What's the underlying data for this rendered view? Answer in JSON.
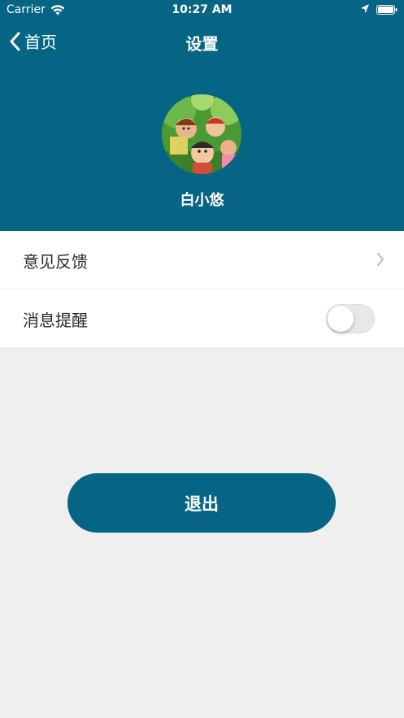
{
  "status_bar": {
    "carrier": "Carrier",
    "time": "10:27 AM",
    "icons": [
      "wifi-icon",
      "location-arrow-icon",
      "battery-icon"
    ]
  },
  "nav": {
    "back_label": "首页",
    "back_icon": "chevron-left-icon",
    "title": "设置"
  },
  "profile": {
    "avatar_icon": "avatar-illustration",
    "username": "白小悠"
  },
  "settings": {
    "items": [
      {
        "label": "意见反馈",
        "accessory": "chevron-right-icon"
      },
      {
        "label": "消息提醒",
        "accessory": "toggle-switch",
        "enabled": false
      }
    ]
  },
  "actions": {
    "logout_label": "退出"
  },
  "colors": {
    "primary": "#066585",
    "background": "#efefef",
    "card": "#ffffff",
    "text": "#2b2b2b"
  }
}
